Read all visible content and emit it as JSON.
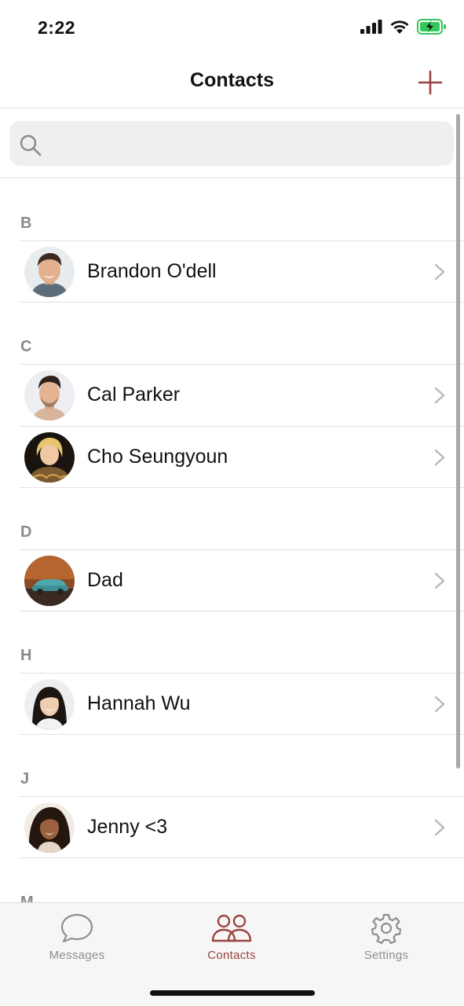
{
  "status_bar": {
    "time": "2:22"
  },
  "nav": {
    "title": "Contacts"
  },
  "search": {
    "placeholder": ""
  },
  "sections": [
    {
      "letter": "B",
      "contacts": [
        {
          "name": "Brandon O'dell",
          "avatar": "man-smiling-portrait"
        }
      ]
    },
    {
      "letter": "C",
      "contacts": [
        {
          "name": "Cal Parker",
          "avatar": "man-portrait"
        },
        {
          "name": "Cho Seungyoun",
          "avatar": "blond-person-portrait"
        }
      ]
    },
    {
      "letter": "D",
      "contacts": [
        {
          "name": "Dad",
          "avatar": "vintage-car-photo"
        }
      ]
    },
    {
      "letter": "H",
      "contacts": [
        {
          "name": "Hannah Wu",
          "avatar": "woman-portrait"
        }
      ]
    },
    {
      "letter": "J",
      "contacts": [
        {
          "name": "Jenny <3",
          "avatar": "woman-curly-hair-portrait"
        }
      ]
    },
    {
      "letter": "M",
      "contacts": []
    }
  ],
  "tabs": [
    {
      "label": "Messages",
      "icon": "chat-bubble-icon",
      "active": false
    },
    {
      "label": "Contacts",
      "icon": "people-icon",
      "active": true
    },
    {
      "label": "Settings",
      "icon": "gear-icon",
      "active": false
    }
  ],
  "colors": {
    "accent": "#9a4440",
    "inactive": "#8e8e8e",
    "battery": "#34c759"
  }
}
